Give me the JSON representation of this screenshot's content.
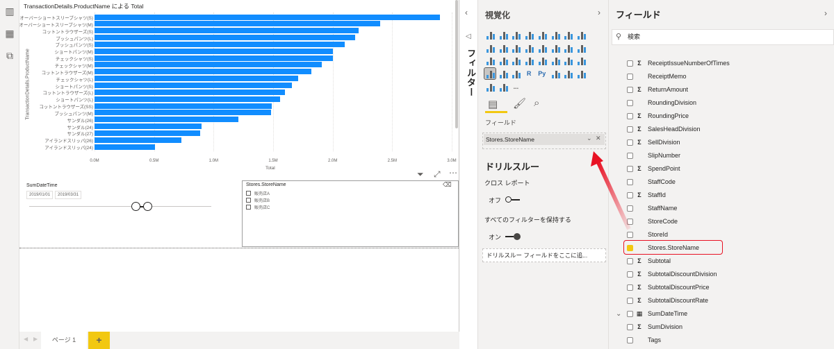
{
  "chart_data": {
    "type": "bar",
    "orientation": "horizontal",
    "title": "TransactionDetails.ProductName による Total",
    "xlabel": "Total",
    "ylabel": "TransactionDetails.ProductName",
    "xlim": [
      0,
      3000000
    ],
    "xticks": [
      "0.0M",
      "0.5M",
      "1.0M",
      "1.5M",
      "2.0M",
      "2.5M",
      "3.0M"
    ],
    "categories": [
      "オーバーショートスリーブシャツ(S)",
      "オーバーショートスリーブシャツ(M)",
      "コットントラウザーズ(S)",
      "ブッシュパンツ(L)",
      "ブッシュパンツ(S)",
      "ショートパンツ(M)",
      "チェックシャツ(S)",
      "チェックシャツ(M)",
      "コットントラウザーズ(M)",
      "チェックシャツ(L)",
      "ショートパンツ(S)",
      "コットントラウザーズ(L)",
      "ショートパンツ(L)",
      "コットントラウザーズ(SS)",
      "ブッシュパンツ(M)",
      "サンダル(26)",
      "サンダル(24)",
      "サンダル(27)",
      "アイランドスリッパ(26)",
      "アイランドスリッパ(24)"
    ],
    "values": [
      2900000,
      2400000,
      2220000,
      2190000,
      2100000,
      2000000,
      2000000,
      1910000,
      1820000,
      1710000,
      1660000,
      1600000,
      1560000,
      1490000,
      1480000,
      1210000,
      900000,
      890000,
      730000,
      510000
    ],
    "color": "#118dff"
  },
  "slicer_date": {
    "title": "SumDateTime",
    "start": "2019/01/01",
    "end": "2019/03/31"
  },
  "slicer_store": {
    "title": "Stores.StoreName",
    "options": [
      "販売店A",
      "販売店B",
      "販売店C"
    ]
  },
  "page_tabs": {
    "page": "ページ 1",
    "add": "+"
  },
  "filter_pane": {
    "label": "フィルター"
  },
  "viz_pane": {
    "title": "視覚化",
    "fields_label": "フィールド",
    "well_value": "Stores.StoreName",
    "drill_title": "ドリルスルー",
    "cross_report": "クロス レポート",
    "cross_state": "オフ",
    "keep_filters": "すべてのフィルターを保持する",
    "keep_state": "オン",
    "drop_placeholder": "ドリルスルー フィールドをここに追...",
    "more": "...",
    "r_label": "R",
    "py_label": "Py"
  },
  "field_pane": {
    "title": "フィールド",
    "search_placeholder": "検索",
    "fields": [
      {
        "name": "ReceiptIssueNumberOfTimes",
        "icon": "Σ",
        "checked": false
      },
      {
        "name": "ReceiptMemo",
        "icon": "",
        "checked": false
      },
      {
        "name": "ReturnAmount",
        "icon": "Σ",
        "checked": false
      },
      {
        "name": "RoundingDivision",
        "icon": "",
        "checked": false
      },
      {
        "name": "RoundingPrice",
        "icon": "Σ",
        "checked": false
      },
      {
        "name": "SalesHeadDivision",
        "icon": "Σ",
        "checked": false
      },
      {
        "name": "SellDivision",
        "icon": "Σ",
        "checked": false
      },
      {
        "name": "SlipNumber",
        "icon": "",
        "checked": false
      },
      {
        "name": "SpendPoint",
        "icon": "Σ",
        "checked": false
      },
      {
        "name": "StaffCode",
        "icon": "",
        "checked": false
      },
      {
        "name": "StaffId",
        "icon": "Σ",
        "checked": false
      },
      {
        "name": "StaffName",
        "icon": "",
        "checked": false
      },
      {
        "name": "StoreCode",
        "icon": "",
        "checked": false
      },
      {
        "name": "StoreId",
        "icon": "",
        "checked": false
      },
      {
        "name": "Stores.StoreName",
        "icon": "",
        "checked": true
      },
      {
        "name": "Subtotal",
        "icon": "Σ",
        "checked": false
      },
      {
        "name": "SubtotalDiscountDivision",
        "icon": "Σ",
        "checked": false
      },
      {
        "name": "SubtotalDiscountPrice",
        "icon": "Σ",
        "checked": false
      },
      {
        "name": "SubtotalDiscountRate",
        "icon": "Σ",
        "checked": false
      },
      {
        "name": "SumDateTime",
        "icon": "▦",
        "checked": false,
        "expandable": true
      },
      {
        "name": "SumDivision",
        "icon": "Σ",
        "checked": false
      },
      {
        "name": "Tags",
        "icon": "",
        "checked": false
      }
    ]
  },
  "colors": {
    "accent": "#f2c811",
    "bar": "#118dff",
    "highlight": "#e81123"
  }
}
